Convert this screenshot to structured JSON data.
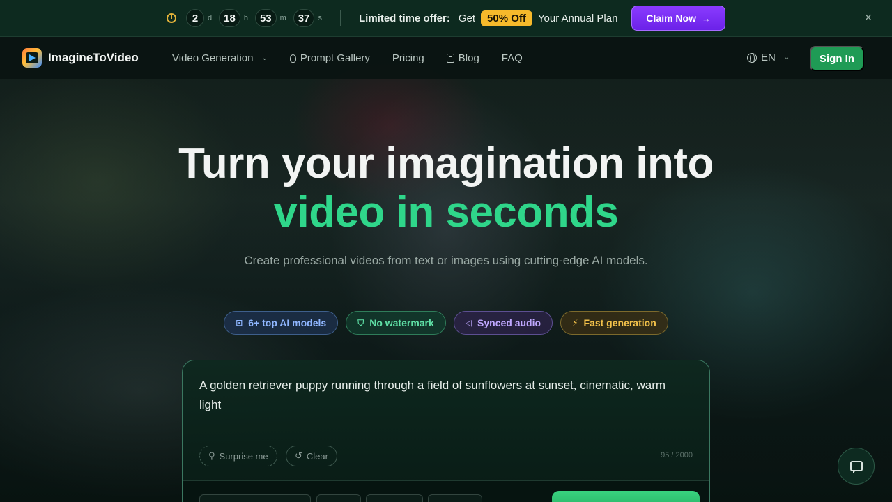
{
  "promo": {
    "countdown": [
      {
        "value": "2",
        "unit": "d"
      },
      {
        "value": "18",
        "unit": "h"
      },
      {
        "value": "53",
        "unit": "m"
      },
      {
        "value": "37",
        "unit": "s"
      }
    ],
    "offer_label": "Limited time offer:",
    "get": "Get",
    "badge": "50% Off",
    "plan": "Your Annual Plan",
    "claim_label": "Claim Now",
    "close": "×",
    "accent_color": "#7b2ff7",
    "badge_color": "#f6b92b"
  },
  "nav": {
    "brand": "ImagineToVideo",
    "links": {
      "video_generation": "Video Generation",
      "prompt_gallery": "Prompt Gallery",
      "pricing": "Pricing",
      "blog": "Blog",
      "faq": "FAQ"
    },
    "language": "EN",
    "sign_in": "Sign In",
    "sign_in_color": "#1f9b55"
  },
  "hero": {
    "title_line1": "Turn your imagination into",
    "title_line2": "video in seconds",
    "subtitle": "Create professional videos from text or images using cutting-edge AI models.",
    "accent_color": "#2fd68a"
  },
  "features": {
    "models": "6+ top AI models",
    "watermark": "No watermark",
    "audio": "Synced audio",
    "fast": "Fast generation"
  },
  "prompt": {
    "text": "A golden retriever puppy running through a field of sunflowers at sunset, cinematic, warm light",
    "surprise": "Surprise me",
    "clear": "Clear",
    "char_count": "95 / 2000"
  }
}
